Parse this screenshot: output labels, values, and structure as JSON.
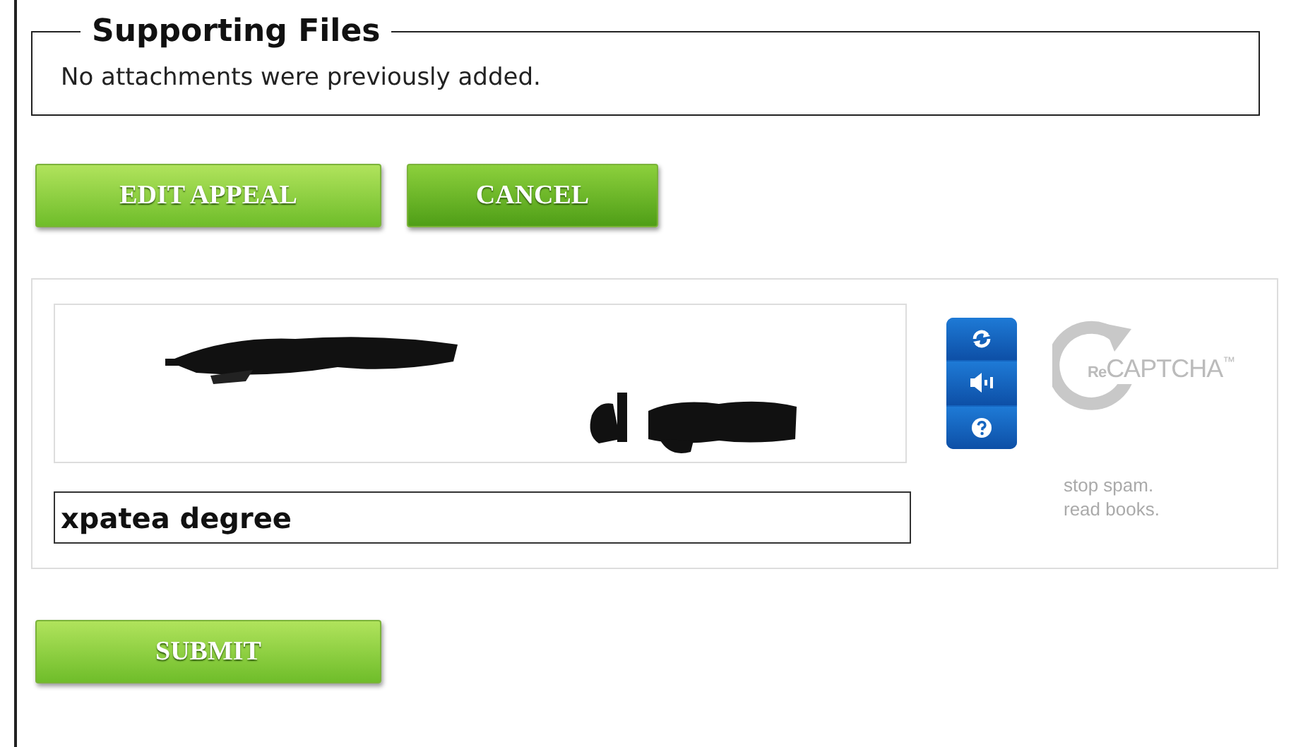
{
  "supporting_files": {
    "legend": "Supporting Files",
    "message": "No attachments were previously added."
  },
  "buttons": [
    {
      "label": "EDIT APPEAL",
      "kind": "light"
    },
    {
      "label": "CANCEL",
      "kind": "dark"
    }
  ],
  "captcha": {
    "response": {
      "value": "xpatea degree"
    },
    "logo": {
      "prefix": "Re",
      "name": "CAPTCHA",
      "mark": "™"
    },
    "tagline": [
      "stop spam.",
      "read books."
    ]
  },
  "submit": {
    "label": "SUBMIT"
  }
}
